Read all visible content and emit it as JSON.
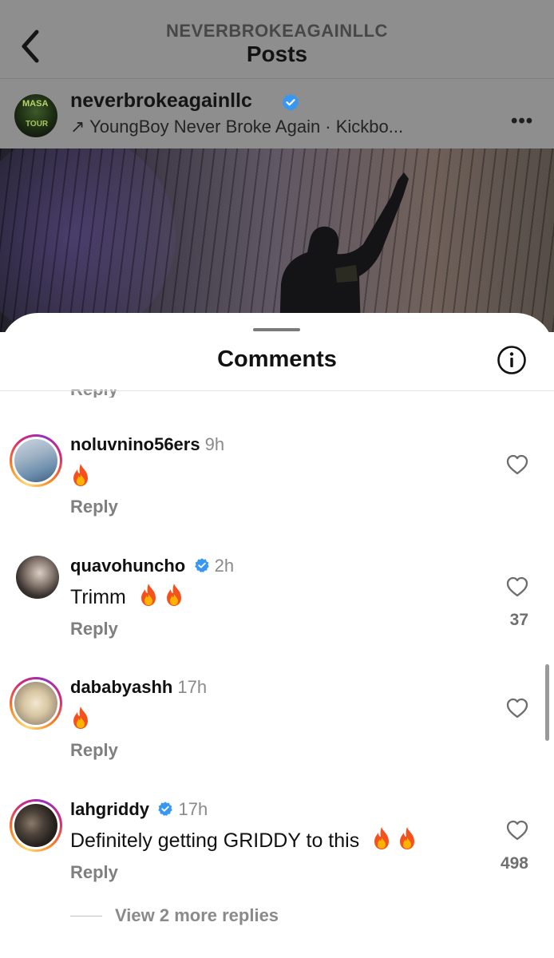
{
  "header": {
    "account": "NEVERBROKEAGAINLLC",
    "title": "Posts"
  },
  "post": {
    "username": "neverbrokeagainllc",
    "verified": true,
    "subtitle": "↗ YoungBoy Never Broke Again · Kickbo...",
    "avatar_text_1": "MASA",
    "avatar_text_2": "TOUR"
  },
  "sheet": {
    "title": "Comments"
  },
  "comments": [
    {
      "username": "noluvnino56ers",
      "time": "9h",
      "verified": false,
      "text": "",
      "emoji_count": 1,
      "reply_label": "Reply",
      "likes": "",
      "story_ring": true
    },
    {
      "username": "quavohuncho",
      "time": "2h",
      "verified": true,
      "text": "Trimm",
      "emoji_count": 2,
      "reply_label": "Reply",
      "likes": "37",
      "story_ring": false
    },
    {
      "username": "dababyashh",
      "time": "17h",
      "verified": false,
      "text": "",
      "emoji_count": 1,
      "reply_label": "Reply",
      "likes": "",
      "story_ring": true
    },
    {
      "username": "lahgriddy",
      "time": "17h",
      "verified": true,
      "text": "Definitely getting GRIDDY to this",
      "emoji_count": 2,
      "reply_label": "Reply",
      "likes": "498",
      "story_ring": true
    }
  ],
  "view_more_replies": "View 2 more replies",
  "partial_reply": "Reply",
  "colors": {
    "verified_blue": "#3897f0",
    "overlay_gray": "#8e8e8e"
  },
  "icons": [
    "back-chevron-icon",
    "verified-badge-icon",
    "more-options-icon",
    "info-icon",
    "heart-icon",
    "fire-emoji"
  ]
}
